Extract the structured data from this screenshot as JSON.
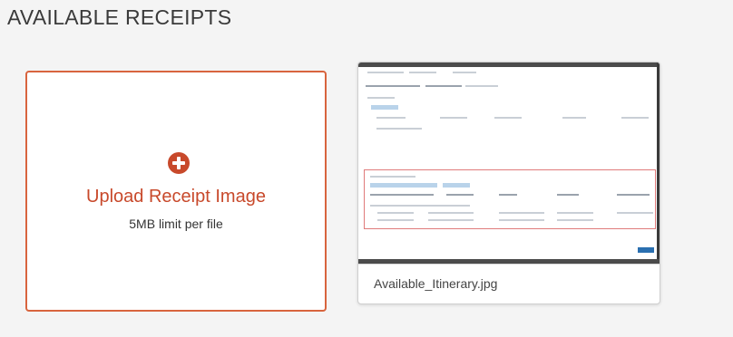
{
  "page": {
    "title": "AVAILABLE RECEIPTS"
  },
  "upload": {
    "label": "Upload Receipt Image",
    "limit": "5MB limit per file",
    "icon": "plus-circle-icon",
    "accent_color": "#c8492b"
  },
  "receipts": [
    {
      "filename": "Available_Itinerary.jpg"
    }
  ]
}
